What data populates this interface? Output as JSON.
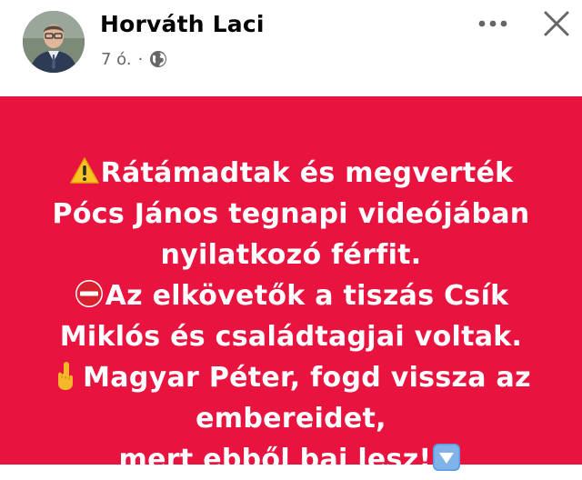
{
  "post": {
    "author": "Horváth Laci",
    "time": "7 ó.",
    "separator": "·",
    "privacy_icon": "globe-icon"
  },
  "header_actions": {
    "more_icon": "more-dots-icon",
    "close_icon": "close-icon"
  },
  "colors": {
    "card_background": "#e8133f",
    "text": "#ffffff",
    "author_text": "#050505",
    "meta_text": "#65676b"
  },
  "card": {
    "lines": [
      {
        "emoji": "warning-emoji",
        "text": "Rátámadtak és megverték"
      },
      {
        "emoji": null,
        "text": "Pócs János tegnapi videójában"
      },
      {
        "emoji": null,
        "text": "nyilatkozó férfit."
      },
      {
        "emoji": "no-entry-emoji",
        "text": "Az elkövetők a tiszás Csík"
      },
      {
        "emoji": null,
        "text": "Miklós és családtagjai voltak."
      },
      {
        "emoji": "pointing-up-hand-emoji",
        "text": "Magyar Péter, fogd vissza az"
      },
      {
        "emoji": null,
        "text": "embereidet,"
      },
      {
        "emoji": null,
        "text": "mert ebből baj lesz!",
        "trailing_emoji": "down-arrow-button-emoji"
      }
    ]
  }
}
